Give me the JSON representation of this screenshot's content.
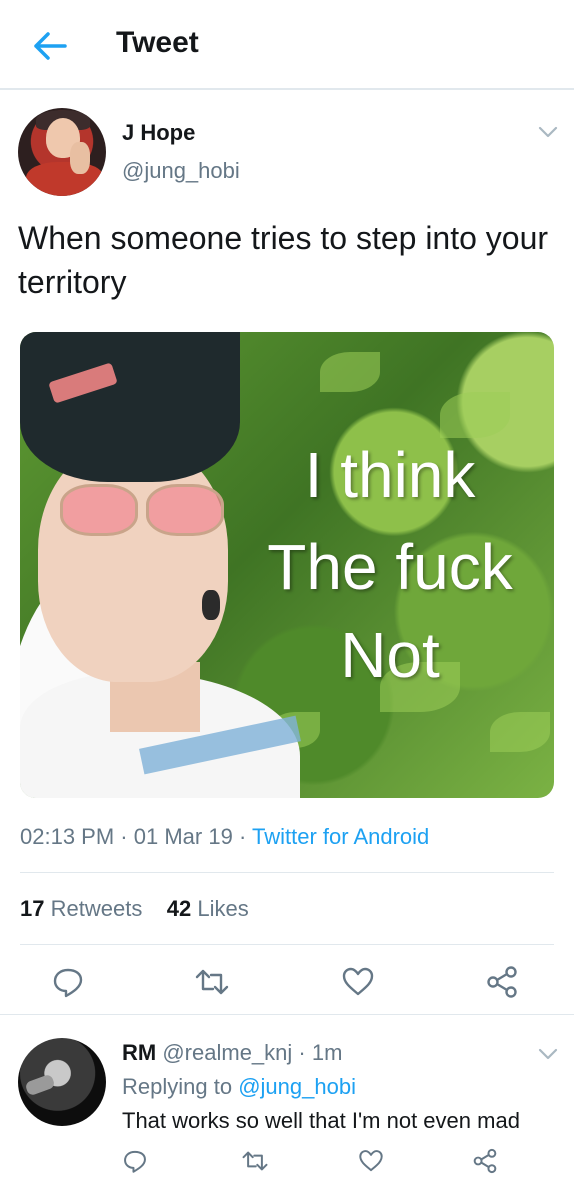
{
  "header": {
    "title": "Tweet",
    "back_icon": "arrow-left-icon",
    "accent_color": "#1da1f2"
  },
  "tweet": {
    "author_name": "J Hope",
    "author_handle": "@jung_hobi",
    "text": "When someone tries to step into your territory",
    "media": {
      "overlay_lines": [
        "I think",
        "The fuck",
        "Not"
      ]
    },
    "time": "02:13 PM",
    "date": "01 Mar 19",
    "source": "Twitter for Android",
    "retweets_count": "17",
    "retweets_label": "Retweets",
    "likes_count": "42",
    "likes_label": "Likes",
    "actions": [
      "reply-icon",
      "retweet-icon",
      "like-icon",
      "share-icon"
    ]
  },
  "reply": {
    "author_name": "RM",
    "author_handle": "@realme_knj",
    "time_ago": "1m",
    "replying_to_label": "Replying to",
    "replying_to_handle": "@jung_hobi",
    "text": "That works so well that I'm not even mad"
  }
}
